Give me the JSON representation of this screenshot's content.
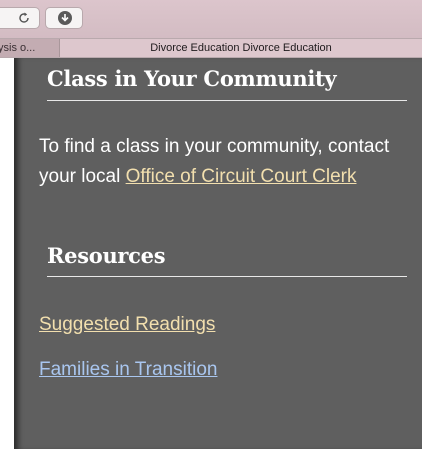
{
  "browser": {
    "tabs": [
      {
        "label": "ysis o...",
        "active": false
      },
      {
        "label": "Divorce Education Divorce Education",
        "active": true
      }
    ]
  },
  "page": {
    "community": {
      "heading": "Class in Your Community",
      "text_before": "To find a class in your community, contact your local ",
      "link_label": "Office of Circuit Court Clerk"
    },
    "resources": {
      "heading": "Resources",
      "links": [
        {
          "label": "Suggested Readings",
          "color": "#f2dfae"
        },
        {
          "label": "Families in Transition",
          "color": "#a9c6ef"
        }
      ]
    }
  },
  "colors": {
    "panel_background": "#5f5f5f",
    "heading_text": "#ffffff",
    "link_visited": "#f2dfae",
    "link_unvisited": "#a9c6ef"
  }
}
